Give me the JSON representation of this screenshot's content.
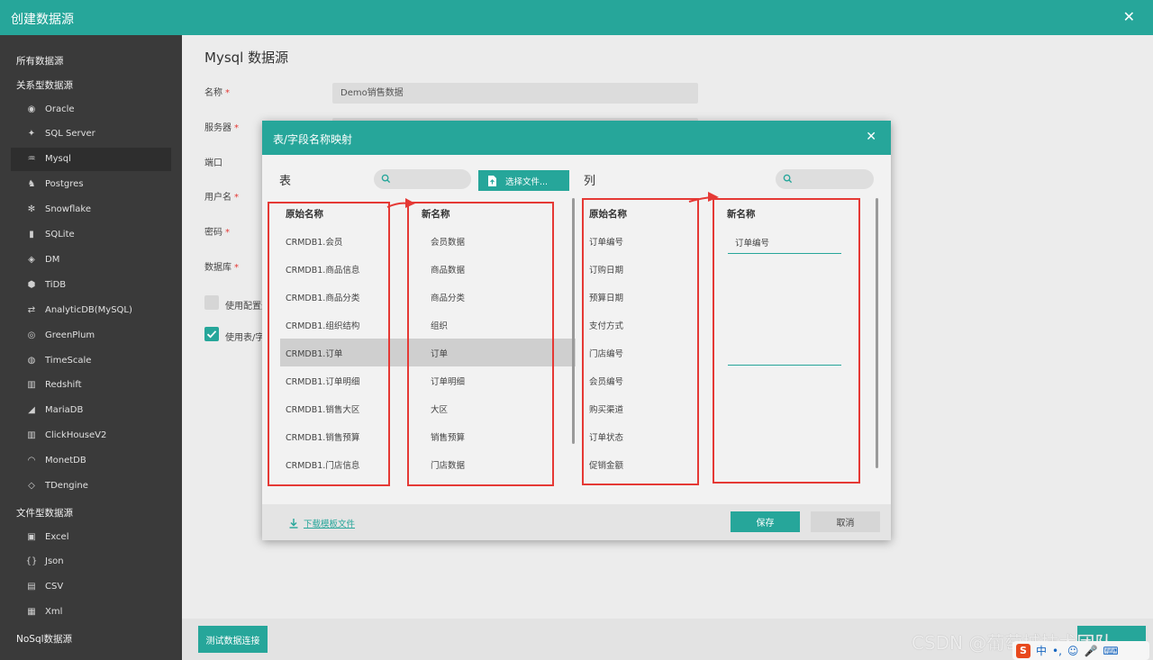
{
  "window": {
    "title": "创建数据源"
  },
  "sidebar": {
    "groups": {
      "all": "所有数据源",
      "relational": "关系型数据源",
      "file": "文件型数据源",
      "nosql": "NoSql数据源"
    },
    "relational_items": [
      {
        "label": "Oracle",
        "icon": "database-icon"
      },
      {
        "label": "SQL Server",
        "icon": "sqlserver-icon"
      },
      {
        "label": "Mysql",
        "icon": "mysql-icon"
      },
      {
        "label": "Postgres",
        "icon": "postgres-icon"
      },
      {
        "label": "Snowflake",
        "icon": "snowflake-icon"
      },
      {
        "label": "SQLite",
        "icon": "sqlite-icon"
      },
      {
        "label": "DM",
        "icon": "dm-icon"
      },
      {
        "label": "TiDB",
        "icon": "tidb-icon"
      },
      {
        "label": "AnalyticDB(MySQL)",
        "icon": "analyticdb-icon"
      },
      {
        "label": "GreenPlum",
        "icon": "greenplum-icon"
      },
      {
        "label": "TimeScale",
        "icon": "timescale-icon"
      },
      {
        "label": "Redshift",
        "icon": "redshift-icon"
      },
      {
        "label": "MariaDB",
        "icon": "mariadb-icon"
      },
      {
        "label": "ClickHouseV2",
        "icon": "clickhouse-icon"
      },
      {
        "label": "MonetDB",
        "icon": "monetdb-icon"
      },
      {
        "label": "TDengine",
        "icon": "tdengine-icon"
      }
    ],
    "file_items": [
      {
        "label": "Excel",
        "icon": "excel-icon"
      },
      {
        "label": "Json",
        "icon": "json-icon"
      },
      {
        "label": "CSV",
        "icon": "csv-icon"
      },
      {
        "label": "Xml",
        "icon": "xml-icon"
      }
    ],
    "active": "Mysql"
  },
  "form": {
    "heading": "Mysql 数据源",
    "fields": {
      "name_label": "名称",
      "name_value": "Demo销售数据",
      "server_label": "服务器",
      "port_label": "端口",
      "user_label": "用户名",
      "password_label": "密码",
      "database_label": "数据库"
    },
    "checkbox_config": "使用配置选项",
    "checkbox_mapping": "使用表/字段名称映射",
    "test_button": "测试数据连接"
  },
  "modal": {
    "title": "表/字段名称映射",
    "table_section": "表",
    "column_section": "列",
    "select_file": "选择文件...",
    "table_headers": {
      "original": "原始名称",
      "new": "新名称"
    },
    "column_headers": {
      "original": "原始名称",
      "new": "新名称"
    },
    "tables": [
      {
        "original": "CRMDB1.会员",
        "new": "会员数据"
      },
      {
        "original": "CRMDB1.商品信息",
        "new": "商品数据"
      },
      {
        "original": "CRMDB1.商品分类",
        "new": "商品分类"
      },
      {
        "original": "CRMDB1.组织结构",
        "new": "组织"
      },
      {
        "original": "CRMDB1.订单",
        "new": "订单"
      },
      {
        "original": "CRMDB1.订单明细",
        "new": "订单明细"
      },
      {
        "original": "CRMDB1.销售大区",
        "new": "大区"
      },
      {
        "original": "CRMDB1.销售预算",
        "new": "销售预算"
      },
      {
        "original": "CRMDB1.门店信息",
        "new": "门店数据"
      }
    ],
    "selected_table": "CRMDB1.订单",
    "columns": [
      "订单编号",
      "订购日期",
      "预算日期",
      "支付方式",
      "门店编号",
      "会员编号",
      "购买渠道",
      "订单状态",
      "促销金额"
    ],
    "column_new_values": [
      "订单编号",
      ""
    ],
    "download_template": "下载模板文件",
    "save": "保存",
    "cancel": "取消"
  },
  "watermark": "CSDN @葡萄城技术团队",
  "ime": {
    "logo": "S",
    "lang": "中"
  }
}
